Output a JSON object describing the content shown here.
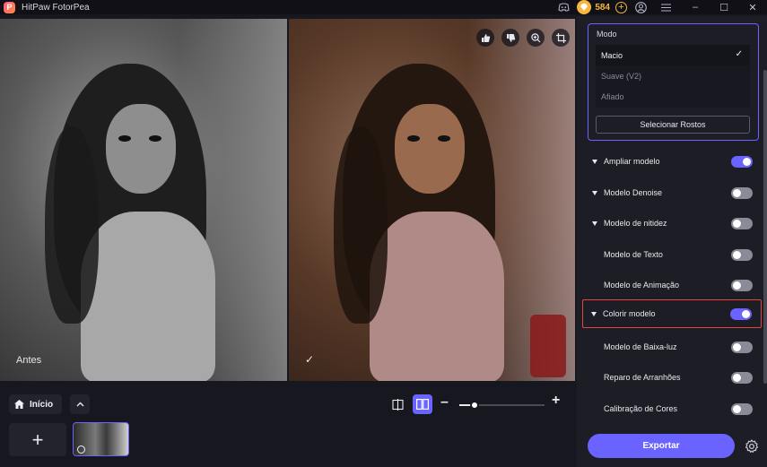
{
  "app": {
    "title": "HitPaw FotorPea",
    "logo_glyph": "P",
    "credits": "584"
  },
  "titlebar_icons": [
    "discord-icon",
    "coin-icon",
    "add-credits-icon",
    "account-icon",
    "menu-icon"
  ],
  "window_controls": {
    "minimize": "–",
    "maximize": "☐",
    "close": "✕"
  },
  "preview": {
    "before_label": "Antes",
    "after_check": "✓",
    "actions": [
      "thumbs-up-icon",
      "thumbs-down-icon",
      "zoom-in-icon",
      "crop-icon"
    ]
  },
  "bottom": {
    "home_label": "Início",
    "add_label": "+",
    "zoom_minus": "–",
    "zoom_plus": "+",
    "zoom_level": 0.18
  },
  "mode": {
    "title": "Modo",
    "options": [
      {
        "label": "Macio",
        "selected": true
      },
      {
        "label": "Suave (V2)",
        "selected": false
      },
      {
        "label": "Afiado",
        "selected": false
      }
    ],
    "select_faces_label": "Selecionar Rostos"
  },
  "models": [
    {
      "label": "Ampliar modelo",
      "expandable": true,
      "on": true,
      "highlight": false
    },
    {
      "label": "Modelo Denoise",
      "expandable": true,
      "on": false,
      "highlight": false
    },
    {
      "label": "Modelo de nitidez",
      "expandable": true,
      "on": false,
      "highlight": false
    },
    {
      "label": "Modelo de Texto",
      "expandable": false,
      "on": false,
      "highlight": false
    },
    {
      "label": "Modelo de Animação",
      "expandable": false,
      "on": false,
      "highlight": false
    },
    {
      "label": "Colorir modelo",
      "expandable": true,
      "on": true,
      "highlight": true
    },
    {
      "label": "Modelo de Baixa-luz",
      "expandable": false,
      "on": false,
      "highlight": false
    },
    {
      "label": "Reparo de Arranhões",
      "expandable": false,
      "on": false,
      "highlight": false
    },
    {
      "label": "Calibração de Cores",
      "expandable": false,
      "on": false,
      "highlight": false
    }
  ],
  "export_label": "Exportar",
  "colors": {
    "accent": "#6a63ff",
    "highlight_border": "#e5453e",
    "coin": "#f6b73c"
  }
}
